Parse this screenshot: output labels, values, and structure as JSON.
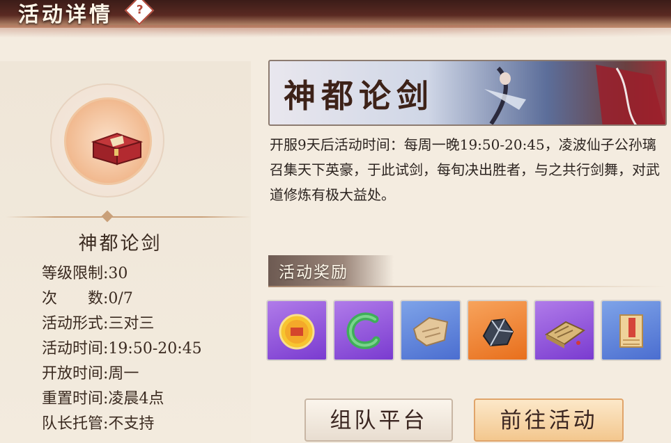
{
  "header": {
    "title": "活动详情",
    "help_icon": "?"
  },
  "left": {
    "activity_name": "神都论剑",
    "info": [
      {
        "label": "等级限制:",
        "value": "30"
      },
      {
        "label": "次　　数:",
        "value": "0/7"
      },
      {
        "label": "活动形式:",
        "value": "三对三"
      },
      {
        "label": "活动时间:",
        "value": "19:50-20:45"
      },
      {
        "label": "开放时间:",
        "value": "周一"
      },
      {
        "label": "重置时间:",
        "value": "凌晨4点"
      },
      {
        "label": "队长托管:",
        "value": "不支持"
      }
    ]
  },
  "banner": {
    "title": "神都论剑"
  },
  "description": "开服9天后活动时间：每周一晚19:50-20:45，凌波仙子公孙璃召集天下英豪，于此试剑，每旬决出胜者，与之共行剑舞，对武道修炼有极大益处。",
  "rewards": {
    "label": "活动奖励",
    "items": [
      {
        "icon": "exp-coin-icon",
        "rarity": "purple"
      },
      {
        "icon": "jade-pendant-icon",
        "rarity": "purple"
      },
      {
        "icon": "parchment-fragment-icon",
        "rarity": "blue"
      },
      {
        "icon": "ore-icon",
        "rarity": "orange"
      },
      {
        "icon": "book-icon",
        "rarity": "purple"
      },
      {
        "icon": "scroll-icon",
        "rarity": "blue"
      }
    ]
  },
  "buttons": {
    "team": "组队平台",
    "go": "前往活动"
  }
}
